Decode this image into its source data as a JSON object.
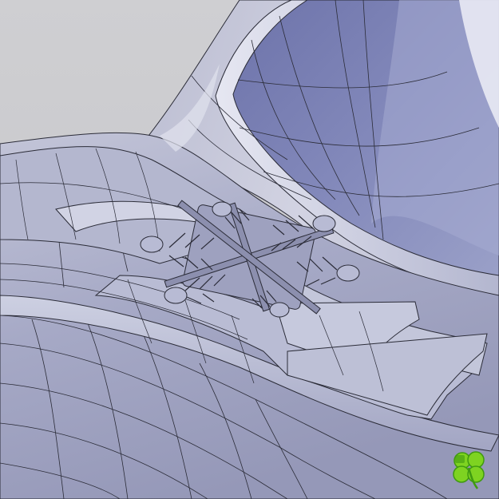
{
  "viewport": {
    "background_color": "#c9c9cc",
    "surface_color": "#a3a6c2",
    "surface_highlight_color": "#e1e2ee",
    "cavity_color": "#7f85b8",
    "mesh_line_color": "#2b2c38"
  },
  "badge": {
    "icon": "four-leaf-clover-icon",
    "color": "#7ed321",
    "accent_color": "#3f9a10"
  }
}
